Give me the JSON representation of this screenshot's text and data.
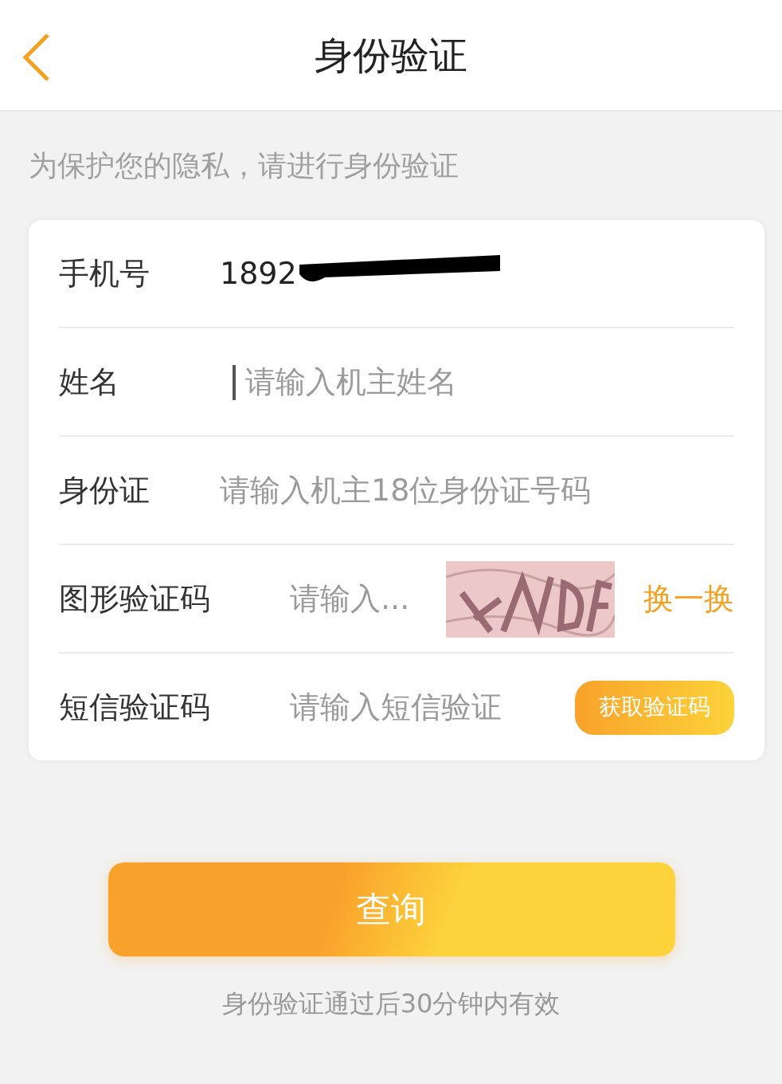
{
  "header": {
    "title": "身份验证"
  },
  "notice": "为保护您的隐私，请进行身份验证",
  "form": {
    "rows": [
      {
        "kind": "text",
        "label": "手机号",
        "value": "1892",
        "redacted": true
      },
      {
        "kind": "input",
        "label": "姓名",
        "placeholder": "请输入机主姓名",
        "focused": true
      },
      {
        "kind": "input",
        "label": "身份证",
        "placeholder": "请输入机主18位身份证号码",
        "focused": false
      },
      {
        "kind": "captcha",
        "label": "图形验证码",
        "placeholder": "请输入...",
        "action": "换一换"
      },
      {
        "kind": "sms",
        "label": "短信验证码",
        "placeholder": "请输入短信验证",
        "action": "获取验证码"
      }
    ]
  },
  "submit": "查询",
  "footnote": "身份验证通过后30分钟内有效"
}
